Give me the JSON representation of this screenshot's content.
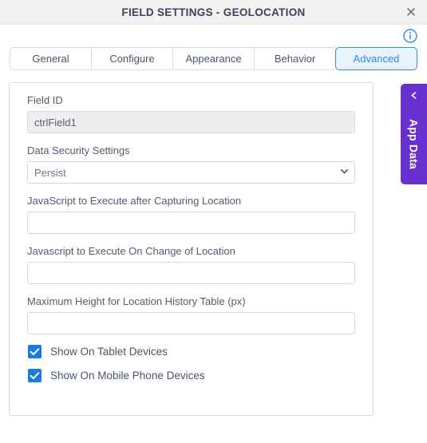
{
  "window": {
    "title": "FIELD SETTINGS - GEOLOCATION",
    "close_label": "✕",
    "info_icon": "info-circle-icon"
  },
  "tabs": [
    {
      "label": "General",
      "active": false
    },
    {
      "label": "Configure",
      "active": false
    },
    {
      "label": "Appearance",
      "active": false
    },
    {
      "label": "Behavior",
      "active": false
    },
    {
      "label": "Advanced",
      "active": true
    }
  ],
  "form": {
    "field_id": {
      "label": "Field ID",
      "value": "ctrlField1",
      "placeholder": ""
    },
    "data_security": {
      "label": "Data Security Settings",
      "value": "Persist",
      "options": [
        "Persist"
      ]
    },
    "js_after_capture": {
      "label": "JavaScript to Execute after Capturing Location",
      "value": "",
      "placeholder": ""
    },
    "js_on_change": {
      "label": "Javascript to Execute On Change of Location",
      "value": "",
      "placeholder": ""
    },
    "max_height": {
      "label": "Maximum Height for Location History Table (px)",
      "value": "",
      "placeholder": ""
    },
    "show_tablet": {
      "label": "Show On Tablet Devices",
      "checked": true
    },
    "show_mobile": {
      "label": "Show On Mobile Phone Devices",
      "checked": true
    }
  },
  "side_panel": {
    "label": "App Data",
    "chevron_icon": "chevron-left-icon",
    "color": "#6930d0"
  },
  "theme": {
    "accent_blue": "#2b8ce6",
    "checkbox_blue": "#1a7ce0",
    "titlebar_bg": "#f2f2f2",
    "readonly_bg": "#eeeeee",
    "border": "#d5d9e0"
  }
}
